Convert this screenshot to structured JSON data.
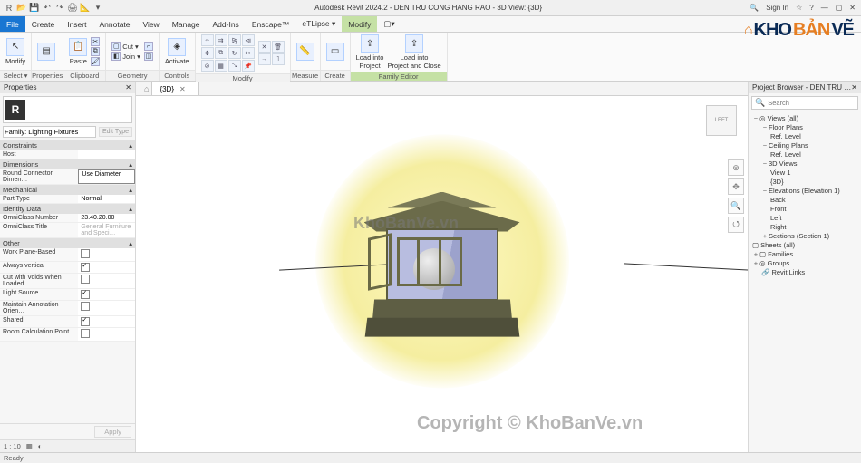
{
  "app": {
    "title": "Autodesk Revit 2024.2 - DEN TRU CONG HANG RAO - 3D View: {3D}",
    "signin": "Sign In",
    "search_placeholder": "Search"
  },
  "ribbon": {
    "tabs": [
      "File",
      "Create",
      "Insert",
      "Annotate",
      "View",
      "Manage",
      "Add-Ins",
      "Enscape™",
      "eTLipse ▾",
      "Modify",
      "▢▾"
    ],
    "panels": {
      "select": "Select ▾",
      "properties": "Properties",
      "clipboard": "Clipboard",
      "geometry": "Geometry",
      "controls": "Controls",
      "modify": "Modify",
      "measure": "Measure",
      "create": "Create",
      "family_editor": "Family Editor"
    },
    "btn": {
      "modify": "Modify",
      "properties": "",
      "paste": "Paste",
      "cut": "Cut ▾",
      "join": "Join ▾",
      "activate": "Activate",
      "load_project": "Load into\nProject",
      "load_close": "Load into\nProject and Close"
    }
  },
  "doc_tab": "{3D}",
  "props": {
    "title": "Properties",
    "family": "Family: Lighting Fixtures",
    "edit_type": "Edit Type",
    "sections": {
      "constraints": "Constraints",
      "dimensions": "Dimensions",
      "mechanical": "Mechanical",
      "identity": "Identity Data",
      "other": "Other"
    },
    "rows": {
      "host": {
        "k": "Host",
        "v": ""
      },
      "round_conn": {
        "k": "Round Connector Dimen…",
        "v": "Use Diameter"
      },
      "part_type": {
        "k": "Part Type",
        "v": "Normal"
      },
      "omni_num": {
        "k": "OmniClass Number",
        "v": "23.40.20.00"
      },
      "omni_title": {
        "k": "OmniClass Title",
        "v": "General Furniture and Speci…"
      },
      "work_plane": {
        "k": "Work Plane-Based",
        "c": false
      },
      "always_vert": {
        "k": "Always vertical",
        "c": true
      },
      "cut_voids": {
        "k": "Cut with Voids When Loaded",
        "c": false
      },
      "light_src": {
        "k": "Light Source",
        "c": true
      },
      "maintain_ann": {
        "k": "Maintain Annotation Orien…",
        "c": false
      },
      "shared": {
        "k": "Shared",
        "c": true
      },
      "room_calc": {
        "k": "Room Calculation Point",
        "c": false
      }
    },
    "ratio": "1 : 10",
    "apply": "Apply"
  },
  "browser": {
    "title": "Project Browser - DEN TRU CONG HANG RAO",
    "search": "Search",
    "nodes": {
      "views": "Views (all)",
      "floor_plans": "Floor Plans",
      "ref_level1": "Ref. Level",
      "ceiling_plans": "Ceiling Plans",
      "ref_level2": "Ref. Level",
      "views3d": "3D Views",
      "view1": "View 1",
      "threeD": "{3D}",
      "elevations": "Elevations (Elevation 1)",
      "back": "Back",
      "front": "Front",
      "left": "Left",
      "right": "Right",
      "sections": "Sections (Section 1)",
      "sheets": "Sheets (all)",
      "families": "Families",
      "groups": "Groups",
      "revit_links": "Revit Links"
    }
  },
  "viewcube": "LEFT",
  "watermarks": {
    "wm1": "KhoBanVe.vn",
    "wm2": "Copyright © KhoBanVe.vn"
  },
  "logo": {
    "pre": "KHO",
    "accent": "BẢN",
    "post": "VẼ"
  },
  "status": "Ready"
}
